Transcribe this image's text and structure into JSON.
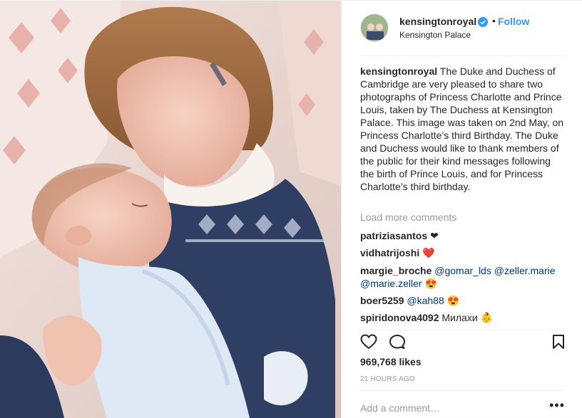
{
  "header": {
    "username": "kensingtonroyal",
    "dot": "•",
    "follow_label": "Follow",
    "location": "Kensington Palace"
  },
  "caption": {
    "username": "kensingtonroyal",
    "text": "The Duke and Duchess of Cambridge are very pleased to share two photographs of Princess Charlotte and Prince Louis, taken by The Duchess at Kensington Palace. This image was taken on 2nd May, on Princess Charlotte’s third Birthday. The Duke and Duchess would like to thank members of the public for their kind messages following the birth of Prince Louis, and for Princess Charlotte’s third birthday."
  },
  "load_more": "Load more comments",
  "comments": [
    {
      "user": "patriziasantos",
      "text": "❤"
    },
    {
      "user": "vidhatrijoshi",
      "text": "❤️"
    },
    {
      "user": "margie_broche",
      "mentions": [
        "@gomar_lds",
        "@zeller.marie",
        "@marie.zeller"
      ],
      "text": "😍"
    },
    {
      "user": "boer5259",
      "mentions": [
        "@kah88"
      ],
      "text": "😍"
    },
    {
      "user": "spiridonova4092",
      "text": "Милахи 👶"
    }
  ],
  "likes": "969,768 likes",
  "time": "21 HOURS AGO",
  "add_comment_placeholder": "Add a comment…",
  "more_options": "•••",
  "icons": {
    "like": "heart-icon",
    "comment": "comment-icon",
    "save": "bookmark-icon",
    "verified": "verified-badge-icon"
  },
  "colors": {
    "link": "#3897f0",
    "mention": "#003569",
    "muted": "#999999",
    "text": "#262626"
  }
}
